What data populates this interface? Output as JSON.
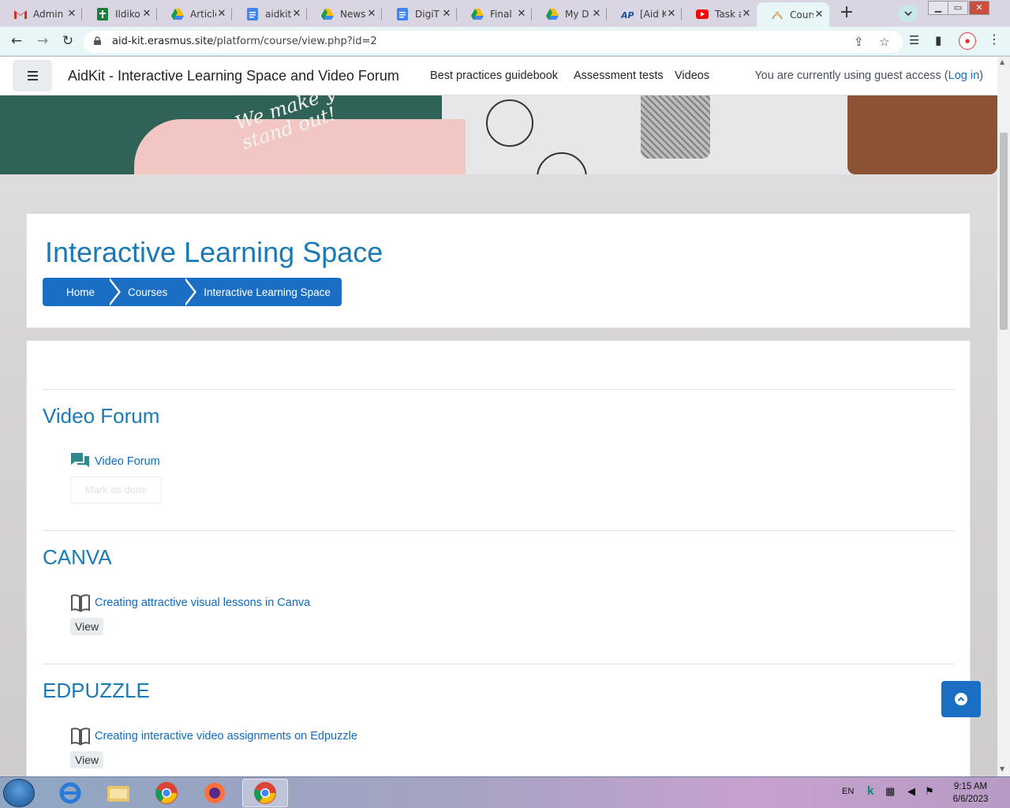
{
  "browser": {
    "tabs": [
      {
        "label": "Admin",
        "icon": "gmail-icon"
      },
      {
        "label": "Ildiko",
        "icon": "sheets-icon"
      },
      {
        "label": "Article",
        "icon": "drive-icon"
      },
      {
        "label": "aidkit",
        "icon": "docs-icon"
      },
      {
        "label": "News",
        "icon": "drive-icon"
      },
      {
        "label": "DigiT",
        "icon": "docs-icon"
      },
      {
        "label": "Final",
        "icon": "drive-icon"
      },
      {
        "label": "My D",
        "icon": "drive-icon"
      },
      {
        "label": "[Aid K",
        "icon": "aidkit-icon"
      },
      {
        "label": "Task a",
        "icon": "youtube-icon"
      },
      {
        "label": "Cours",
        "icon": "moodle-icon"
      }
    ],
    "url_domain": "aid-kit.erasmus.site",
    "url_path": "/platform/course/view.php?id=2"
  },
  "navbar": {
    "site_name": "AidKit - Interactive Learning Space and Video Forum",
    "links": [
      "Best practices guidebook",
      "Assessment tests",
      "Videos"
    ],
    "guest_text": "You are currently using guest access (",
    "login_label": "Log in",
    "guest_close": ")"
  },
  "hero": {
    "slogan_line1": "We make y",
    "slogan_line2": "stand out!"
  },
  "header": {
    "title": "Interactive Learning Space",
    "breadcrumbs": [
      "Home",
      "Courses",
      "Interactive Learning Space"
    ]
  },
  "sections": [
    {
      "title": "Video Forum",
      "activity": "Video Forum",
      "action": "Mark as done",
      "icon": "forum-icon"
    },
    {
      "title": "CANVA",
      "activity": "Creating attractive visual lessons in Canva",
      "action": "View",
      "icon": "book-icon"
    },
    {
      "title": "EDPUZZLE",
      "activity": "Creating interactive video assignments on Edpuzzle",
      "action": "View",
      "icon": "book-icon"
    }
  ],
  "taskbar": {
    "lang": "EN",
    "time": "9:15 AM",
    "date": "6/6/2023"
  },
  "colors": {
    "accent": "#1a6fc4",
    "link": "#0f6cbf",
    "title": "#1a7ab8"
  }
}
